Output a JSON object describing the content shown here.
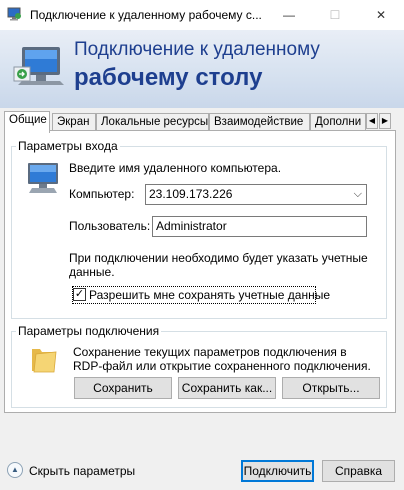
{
  "window": {
    "title": "Подключение к удаленному рабочему с...",
    "minimize_glyph": "—",
    "maximize_glyph": "☐",
    "close_glyph": "✕"
  },
  "banner": {
    "line1": "Подключение к удаленному",
    "line2": "рабочему столу"
  },
  "tabs": [
    {
      "label": "Общие",
      "active": true
    },
    {
      "label": "Экран"
    },
    {
      "label": "Локальные ресурсы"
    },
    {
      "label": "Взаимодействие"
    },
    {
      "label": "Дополни"
    }
  ],
  "tab_scroll": {
    "left_glyph": "◀",
    "right_glyph": "▶"
  },
  "login": {
    "group_title": "Параметры входа",
    "instruction": "Введите имя удаленного компьютера.",
    "computer_label": "Компьютер:",
    "computer_value": "23.109.173.226",
    "dropdown_glyph": "⌵",
    "user_label": "Пользователь:",
    "user_value": "Administrator",
    "note_line1": "При подключении необходимо будет указать учетные",
    "note_line2": "данные.",
    "save_creds_label": "Разрешить мне сохранять учетные данные",
    "save_creds_checked": true,
    "check_glyph": "✓"
  },
  "connection": {
    "group_title": "Параметры подключения",
    "desc_line1": "Сохранение текущих параметров подключения в",
    "desc_line2": "RDP-файл или открытие сохраненного подключения.",
    "save_label": "Сохранить",
    "save_as_label": "Сохранить как...",
    "open_label": "Открыть..."
  },
  "footer": {
    "hide_options_label": "Скрыть параметры",
    "hide_options_glyph": "▲",
    "connect_label": "Подключить",
    "help_label": "Справка"
  },
  "colors": {
    "banner_text": "#1e3f8f",
    "accent": "#0078d7"
  }
}
